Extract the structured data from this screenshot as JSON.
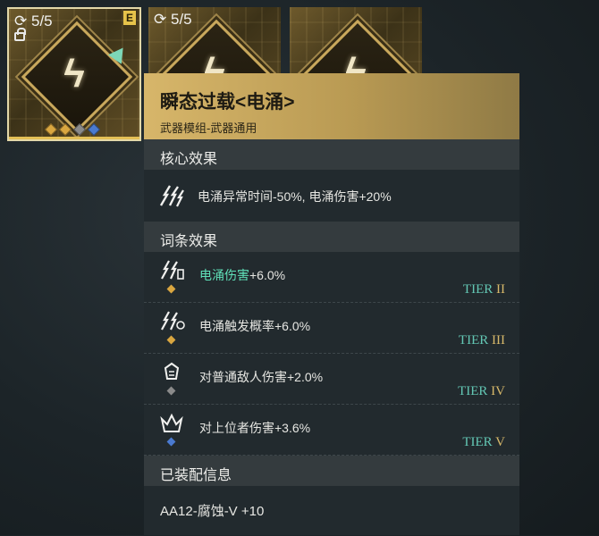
{
  "cards": [
    {
      "counter": "5/5",
      "badge": "E",
      "gems": [
        "#d9a640",
        "#d9a640",
        "#8a8a8a",
        "#4a7ad0"
      ]
    },
    {
      "counter": "5/5"
    },
    {
      "counter": ""
    }
  ],
  "icons": {
    "refresh": "refresh-icon",
    "lock": "lock-icon",
    "module": "lightning-module-icon"
  },
  "panel": {
    "title": "瞬态过载<电涌>",
    "subtitle": "武器模组-武器通用",
    "core_section": "核心效果",
    "core_effect": "电涌异常时间-50%, 电涌伤害+20%",
    "affix_section": "词条效果",
    "affixes": [
      {
        "highlight": "电涌伤害",
        "rest": "+6.0%",
        "tier_prefix": "TIER ",
        "tier_roman": "II",
        "gem": "#d9a640"
      },
      {
        "highlight": "",
        "rest": "电涌触发概率+6.0%",
        "tier_prefix": "TIER ",
        "tier_roman": "III",
        "gem": "#d9a640"
      },
      {
        "highlight": "",
        "rest": "对普通敌人伤害+2.0%",
        "tier_prefix": "TIER ",
        "tier_roman": "IV",
        "gem": "#8a8a8a"
      },
      {
        "highlight": "",
        "rest": "对上位者伤害+3.6%",
        "tier_prefix": "TIER ",
        "tier_roman": "V",
        "gem": "#4a7ad0"
      }
    ],
    "equip_section": "已装配信息",
    "equip_info": "AA12-腐蚀-V +10"
  },
  "colors": {
    "gold": "#d7b66a",
    "highlight": "#5fe0b8",
    "tier": "#63c7b4"
  }
}
